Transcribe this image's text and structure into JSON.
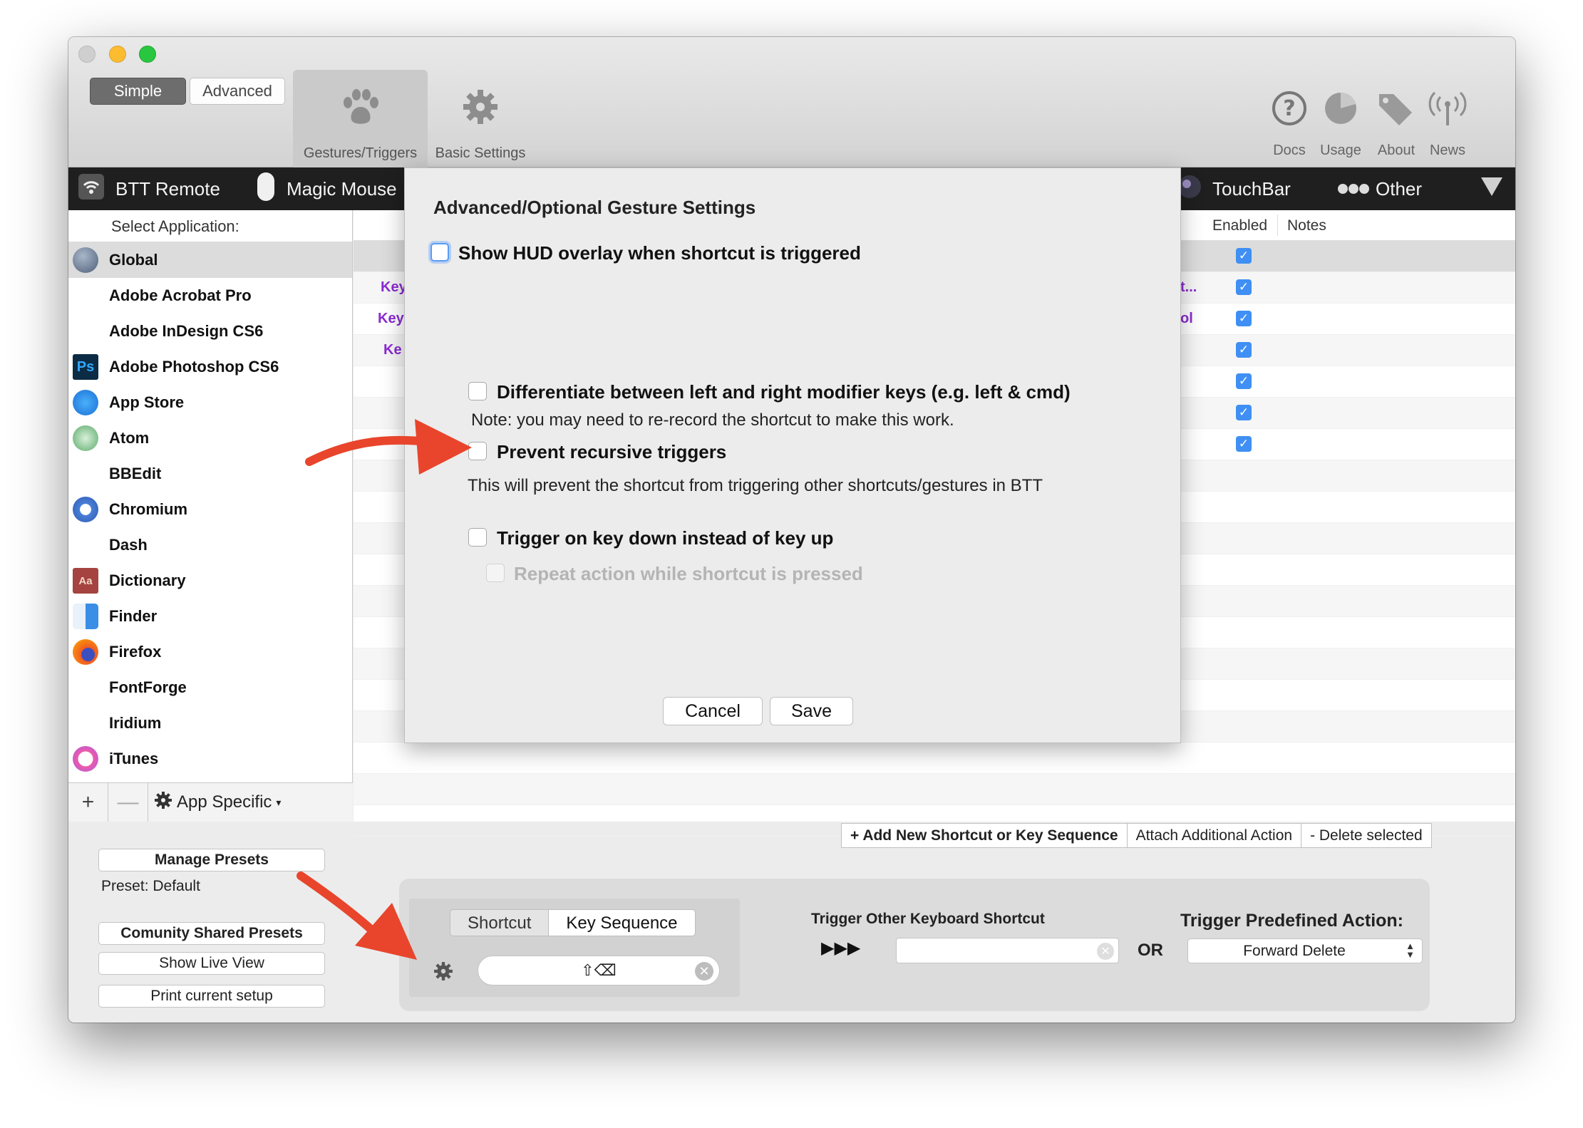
{
  "toolbar": {
    "mode_simple": "Simple",
    "mode_advanced": "Advanced",
    "gestures_label": "Gestures/Triggers",
    "basic_settings_label": "Basic Settings",
    "docs_label": "Docs",
    "usage_label": "Usage",
    "about_label": "About",
    "news_label": "News"
  },
  "devices": {
    "btt_remote": "BTT Remote",
    "magic_mouse": "Magic Mouse",
    "touchbar": "TouchBar",
    "other": "Other"
  },
  "sidebar": {
    "header": "Select Application:",
    "apps": [
      {
        "label": "Global"
      },
      {
        "label": "Adobe Acrobat Pro"
      },
      {
        "label": "Adobe InDesign CS6"
      },
      {
        "label": "Adobe Photoshop CS6"
      },
      {
        "label": "App Store"
      },
      {
        "label": "Atom"
      },
      {
        "label": "BBEdit"
      },
      {
        "label": "Chromium"
      },
      {
        "label": "Dash"
      },
      {
        "label": "Dictionary"
      },
      {
        "label": "Finder"
      },
      {
        "label": "Firefox"
      },
      {
        "label": "FontForge"
      },
      {
        "label": "Iridium"
      },
      {
        "label": "iTunes"
      }
    ],
    "add": "+",
    "remove": "—",
    "app_specific": "App Specific"
  },
  "table": {
    "col_enabled": "Enabled",
    "col_notes": "Notes",
    "fragments": {
      "k1": "Key",
      "k2": "Key",
      "k3": "Ke",
      "r1": "t...",
      "r2": "ol"
    }
  },
  "actions": {
    "add_new": "+ Add New Shortcut or Key Sequence",
    "attach": "Attach Additional Action",
    "delete": "- Delete selected"
  },
  "presets": {
    "manage": "Manage Presets",
    "preset_line": "Preset: Default",
    "community": "Comunity Shared Presets",
    "live_view": "Show Live View",
    "print_setup": "Print current setup"
  },
  "editor": {
    "tab_shortcut": "Shortcut",
    "tab_key_sequence": "Key Sequence",
    "recorded_shortcut": "⇧⌫",
    "arrows": "▶▶▶",
    "trigger_other_label": "Trigger Other Keyboard Shortcut",
    "or_label": "OR",
    "predefined_label": "Trigger Predefined Action:",
    "predefined_value": "Forward Delete"
  },
  "sheet": {
    "title": "Advanced/Optional Gesture Settings",
    "opt_hud": "Show HUD overlay when shortcut is triggered",
    "opt_differentiate": "Differentiate between left and right modifier keys (e.g. left & cmd)",
    "note_differentiate": "Note: you may need to re-record the shortcut to make this work.",
    "opt_prevent": "Prevent recursive triggers",
    "note_prevent": "This will prevent the shortcut from triggering other shortcuts/gestures in BTT",
    "opt_keydown": "Trigger on key down instead of key up",
    "opt_repeat": "Repeat action while shortcut is pressed",
    "cancel": "Cancel",
    "save": "Save"
  },
  "colors": {
    "accent_blue": "#3f8ff4",
    "annotation_arrow": "#e8452c",
    "purple_text": "#8b2bd1"
  }
}
